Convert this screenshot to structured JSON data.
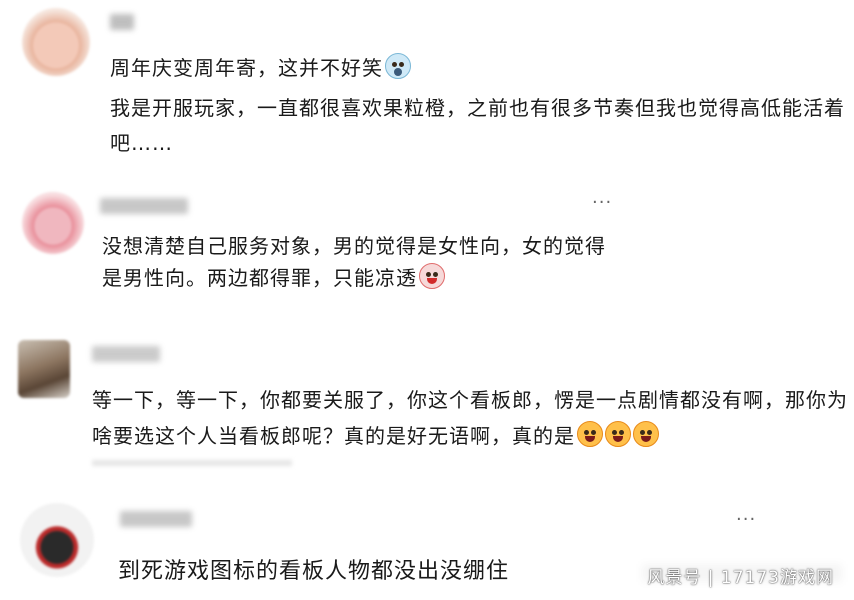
{
  "comments": [
    {
      "lines": [
        "周年庆变周年寄，这并不好笑",
        "我是开服玩家，一直都很喜欢果粒橙，之前也有很多节奏但我也觉得高低能活着",
        "吧……"
      ],
      "emoji": "face-screaming-icon"
    },
    {
      "lines": [
        "没想清楚自己服务对象，男的觉得是女性向，女的觉得",
        "是男性向。两边都得罪，只能凉透"
      ],
      "emoji": "clown-face-icon",
      "more": "···"
    },
    {
      "lines": [
        "等一下，等一下，你都要关服了，你这个看板郎，愣是一点剧情都没有啊，那你为",
        "啥要选这个人当看板郎呢？真的是好无语啊，真的是"
      ],
      "emoji": "angry-face-icon"
    },
    {
      "lines": [
        "到死游戏图标的看板人物都没出没绷住"
      ],
      "more": "···"
    }
  ],
  "watermark": "风景号 | 17173游戏网"
}
